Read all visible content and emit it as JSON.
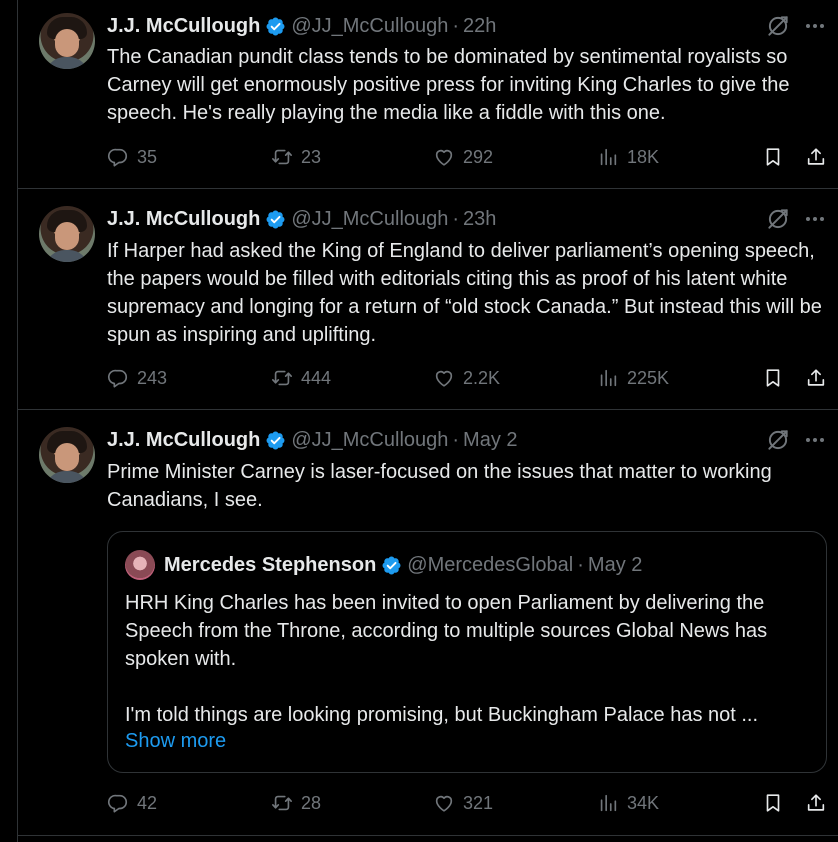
{
  "tweets": [
    {
      "author": "J.J. McCullough",
      "handle": "@JJ_McCullough",
      "time": "22h",
      "text": "The Canadian pundit class tends to be dominated by sentimental royalists so Carney will get enormously positive press for inviting King Charles to give the speech. He's really playing the media like a fiddle with this one.",
      "replies": "35",
      "reposts": "23",
      "likes": "292",
      "views": "18K"
    },
    {
      "author": "J.J. McCullough",
      "handle": "@JJ_McCullough",
      "time": "23h",
      "text": "If Harper had asked the King of England to deliver parliament’s opening speech, the papers would be filled with editorials citing this as proof of his latent white supremacy and longing for a return of “old stock Canada.” But instead this will be spun as inspiring and uplifting.",
      "replies": "243",
      "reposts": "444",
      "likes": "2.2K",
      "views": "225K"
    },
    {
      "author": "J.J. McCullough",
      "handle": "@JJ_McCullough",
      "time": "May 2",
      "text": "Prime Minister Carney is laser-focused on the issues that matter to working Canadians, I see.",
      "replies": "42",
      "reposts": "28",
      "likes": "321",
      "views": "34K",
      "quote": {
        "author": "Mercedes Stephenson",
        "handle": "@MercedesGlobal",
        "time": "May 2",
        "paragraph1": "HRH King Charles has been invited to open Parliament by delivering the Speech from the Throne, according to multiple sources Global News has spoken with.",
        "paragraph2": "I'm told things are looking promising, but Buckingham Palace has not ...",
        "show_more": "Show more"
      }
    }
  ],
  "separator": "·",
  "colors": {
    "background": "#000000",
    "text": "#e7e9ea",
    "muted": "#71767b",
    "accent": "#1d9bf0",
    "border": "#2f3336"
  },
  "icons": [
    "verified-badge-icon",
    "grok-icon",
    "more-icon",
    "reply-icon",
    "repost-icon",
    "like-icon",
    "views-icon",
    "bookmark-icon",
    "share-icon"
  ]
}
